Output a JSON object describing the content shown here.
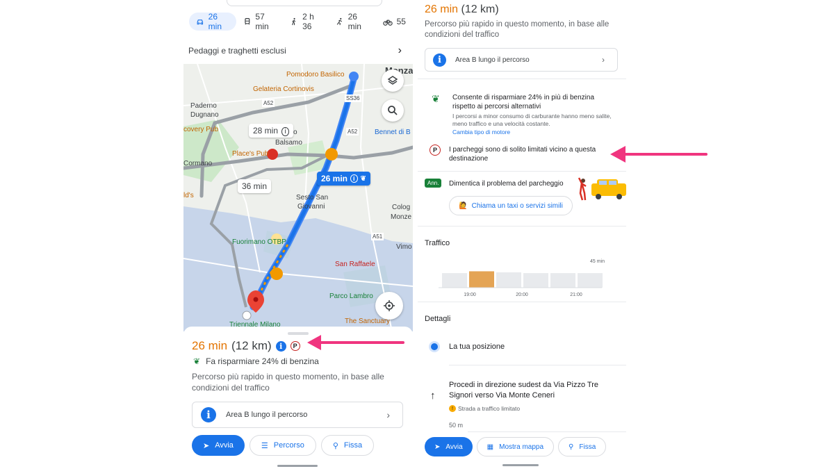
{
  "colors": {
    "accent": "#1a73e8",
    "duration": "#e37400",
    "arrow": "#f0357f",
    "eco": "#188038",
    "parking": "#c5221f"
  },
  "left": {
    "modes": [
      {
        "icon": "car-icon",
        "label": "26 min",
        "active": true
      },
      {
        "icon": "train-icon",
        "label": "57 min"
      },
      {
        "icon": "walk-icon",
        "label": "2 h 36"
      },
      {
        "icon": "run-icon",
        "label": "26 min"
      },
      {
        "icon": "bike-icon",
        "label": "55"
      }
    ],
    "tolls": "Pedaggi e traghetti esclusi",
    "map": {
      "labels": {
        "monza": "Monza",
        "pomodoro": "Pomodoro Basilico",
        "gelateria": "Gelateria Cortinovis",
        "paderno": "Paderno",
        "dugnano": "Dugnano",
        "covery": "covery Pub",
        "ello": "ello",
        "balsamo": "Balsamo",
        "bennet": "Bennet di B",
        "places": "Place's Pub",
        "cormano": "Cormano",
        "sesto": "Sesto San",
        "giovanni": "Giovanni",
        "cologno": "Colog",
        "monze": "Monze",
        "ids": "ld's",
        "fuorimano": "Fuorimano OTBP",
        "vimo": "Vimo",
        "sanraffaele": "San Raffaele",
        "parcolambro": "Parco Lambro",
        "triennale": "Triennale Milano",
        "sanctuary": "The Sanctuary",
        "a52": "A52",
        "a52b": "A52",
        "ss36": "SS36",
        "a51": "A51"
      },
      "alt_time_1": "28 min",
      "alt_time_2": "36 min",
      "selected_time": "26 min"
    },
    "sheet": {
      "duration": "26 min",
      "distance": "(12 km)",
      "parking_symbol": "P",
      "eco": "Fa risparmiare 24% di benzina",
      "description": "Percorso più rapido in questo momento, in base alle condizioni del traffico",
      "area_b": "Area B lungo il percorso",
      "buttons": {
        "start": "Avvia",
        "route": "Percorso",
        "pin": "Fissa"
      }
    }
  },
  "right": {
    "duration": "26 min",
    "distance": "(12 km)",
    "description": "Percorso più rapido in questo momento, in base alle condizioni del traffico",
    "area_b": "Area B lungo il percorso",
    "eco_title": "Consente di risparmiare 24% in più di benzina rispetto ai percorsi alternativi",
    "eco_sub": "I percorsi a minor consumo di carburante hanno meno salite, meno traffico e una velocità costante.",
    "eco_link": "Cambia tipo di motore",
    "parking_symbol": "P",
    "parking_note": "I parcheggi sono di solito limitati vicino a questa destinazione",
    "ad_badge": "Ann.",
    "parking_ad_title": "Dimentica il problema del parcheggio",
    "taxi_button": "Chiama un taxi o servizi simili",
    "traffic_title": "Traffico",
    "traffic_max_label": "45 min",
    "traffic_ticks": [
      "19:00",
      "20:00",
      "21:00"
    ],
    "traffic_levels": [
      0.55,
      0.62,
      0.58,
      0.55,
      0.55,
      0.55
    ],
    "traffic_highlight_index": 1,
    "details_title": "Dettagli",
    "position": "La tua posizione",
    "step": "Procedi in direzione sudest da Via Pizzo Tre Signori verso Via Monte Ceneri",
    "step_warning": "Strada a traffico limitato",
    "step_distance": "50 m",
    "buttons": {
      "start": "Avvia",
      "map": "Mostra mappa",
      "pin": "Fissa"
    }
  }
}
